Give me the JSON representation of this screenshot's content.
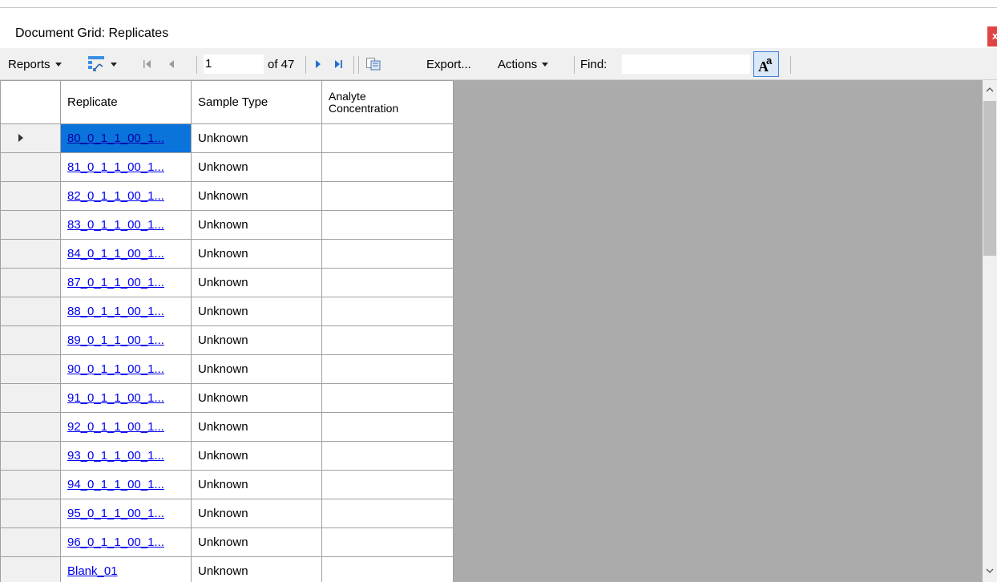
{
  "window": {
    "title": "Document Grid: Replicates",
    "close_label": "x"
  },
  "toolbar": {
    "reports_label": "Reports",
    "position_value": "1",
    "of_label": "of 47",
    "export_label": "Export...",
    "actions_label": "Actions",
    "find_label": "Find:",
    "find_value": ""
  },
  "grid": {
    "columns": [
      "Replicate",
      "Sample Type",
      "Analyte\nConcentration"
    ],
    "column_line1": "Analyte",
    "column_line2": "Concentration",
    "rows": [
      {
        "replicate": "80_0_1_1_00_1...",
        "sample_type": "Unknown",
        "concentration": ""
      },
      {
        "replicate": "81_0_1_1_00_1...",
        "sample_type": "Unknown",
        "concentration": ""
      },
      {
        "replicate": "82_0_1_1_00_1...",
        "sample_type": "Unknown",
        "concentration": ""
      },
      {
        "replicate": "83_0_1_1_00_1...",
        "sample_type": "Unknown",
        "concentration": ""
      },
      {
        "replicate": "84_0_1_1_00_1...",
        "sample_type": "Unknown",
        "concentration": ""
      },
      {
        "replicate": "87_0_1_1_00_1...",
        "sample_type": "Unknown",
        "concentration": ""
      },
      {
        "replicate": "88_0_1_1_00_1...",
        "sample_type": "Unknown",
        "concentration": ""
      },
      {
        "replicate": "89_0_1_1_00_1...",
        "sample_type": "Unknown",
        "concentration": ""
      },
      {
        "replicate": "90_0_1_1_00_1...",
        "sample_type": "Unknown",
        "concentration": ""
      },
      {
        "replicate": "91_0_1_1_00_1...",
        "sample_type": "Unknown",
        "concentration": ""
      },
      {
        "replicate": "92_0_1_1_00_1...",
        "sample_type": "Unknown",
        "concentration": ""
      },
      {
        "replicate": "93_0_1_1_00_1...",
        "sample_type": "Unknown",
        "concentration": ""
      },
      {
        "replicate": "94_0_1_1_00_1...",
        "sample_type": "Unknown",
        "concentration": ""
      },
      {
        "replicate": "95_0_1_1_00_1...",
        "sample_type": "Unknown",
        "concentration": ""
      },
      {
        "replicate": "96_0_1_1_00_1...",
        "sample_type": "Unknown",
        "concentration": ""
      },
      {
        "replicate": "Blank_01",
        "sample_type": "Unknown",
        "concentration": ""
      }
    ]
  },
  "colors": {
    "selection": "#0a74db",
    "link": "#0000ee",
    "empty_area": "#ababab",
    "close": "#e04343"
  }
}
